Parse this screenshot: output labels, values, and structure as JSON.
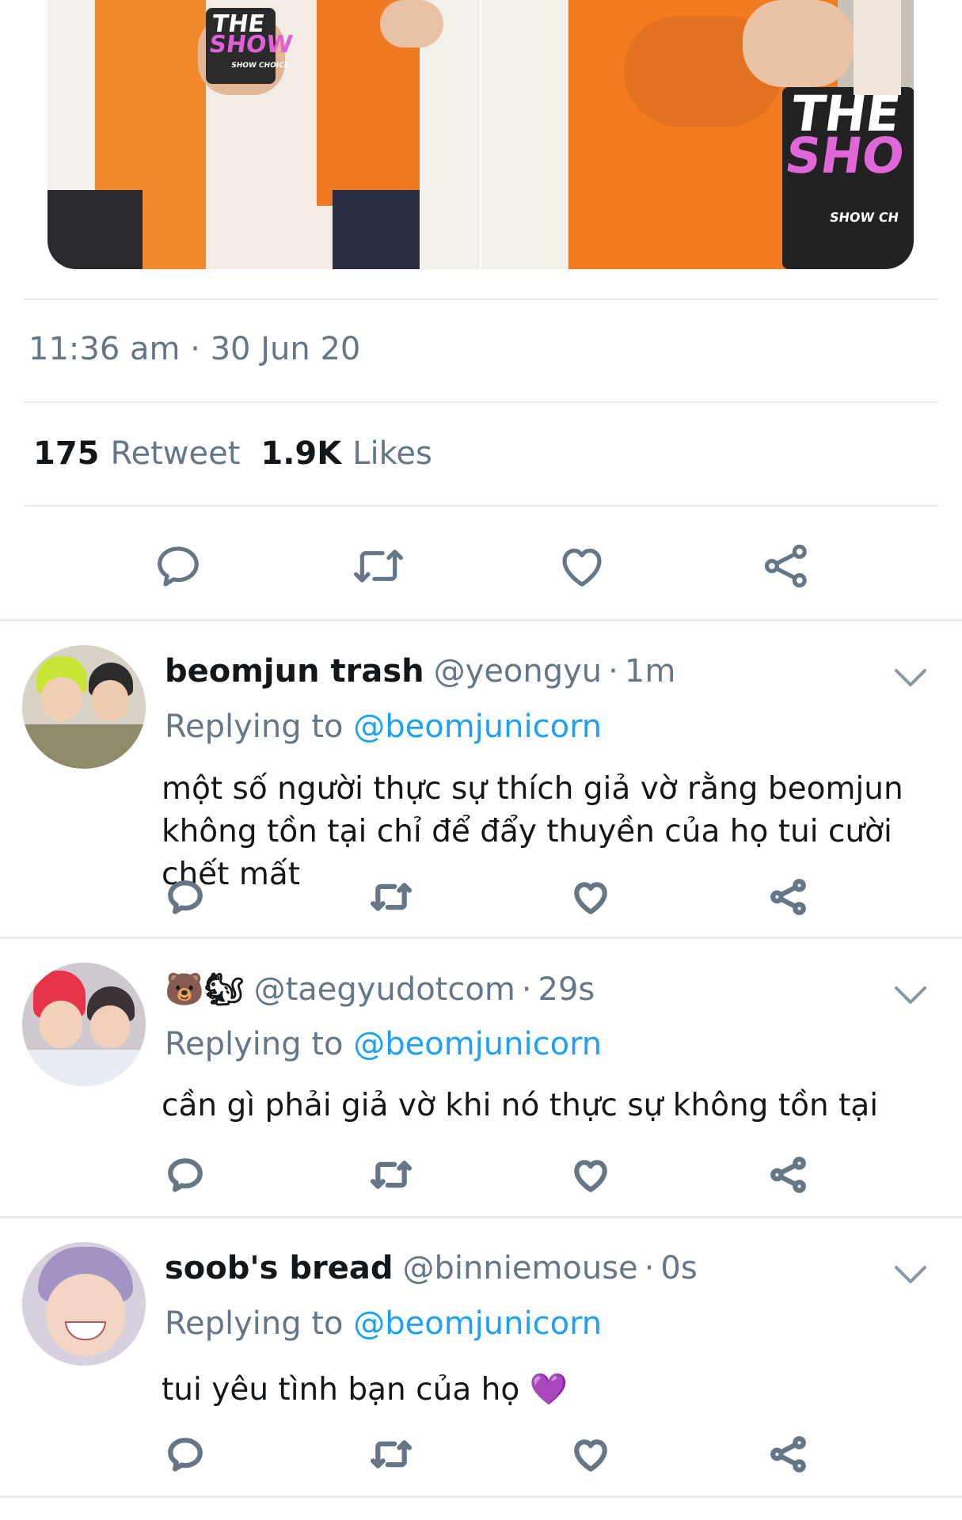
{
  "tweet": {
    "timestamp": "11:36 am · 30 Jun 20",
    "retweet_count": "175",
    "retweet_label": "Retweet",
    "like_count": "1.9K",
    "like_label": "Likes",
    "photo_left_text": [
      "THE",
      "SHOW"
    ],
    "photo_right_text": [
      "THE",
      "SHO"
    ],
    "photo_right_small": "SHOW CH",
    "photo_left_small": "SHOW CHOICE"
  },
  "icons": {
    "reply": "reply-icon",
    "retweet": "retweet-icon",
    "like": "heart-icon",
    "share": "share-icon",
    "more": "chevron-down-icon"
  },
  "colors": {
    "link": "#1da1f2",
    "secondary": "#657786",
    "divider": "#e6ecf0"
  },
  "replies": [
    {
      "name": "beomjun trash",
      "handle": "@yeongyu",
      "separator": "·",
      "time": "1m",
      "replying_prefix": "Replying to",
      "replying_to": "@beomjunicorn",
      "text": "một số người thực sự thích giả vờ rằng beomjun không tồn tại chỉ để đẩy thuyền của họ tui cười chết mất"
    },
    {
      "name": "🐻🐿",
      "handle": "@taegyudotcom",
      "separator": "·",
      "time": "29s",
      "replying_prefix": "Replying to",
      "replying_to": "@beomjunicorn",
      "text": "cần gì phải giả vờ khi nó thực sự không tồn tại"
    },
    {
      "name": "soob's bread",
      "handle": "@binniemouse",
      "separator": "·",
      "time": "0s",
      "replying_prefix": "Replying to",
      "replying_to": "@beomjunicorn",
      "text": "tui yêu tình bạn của họ 💜"
    }
  ]
}
